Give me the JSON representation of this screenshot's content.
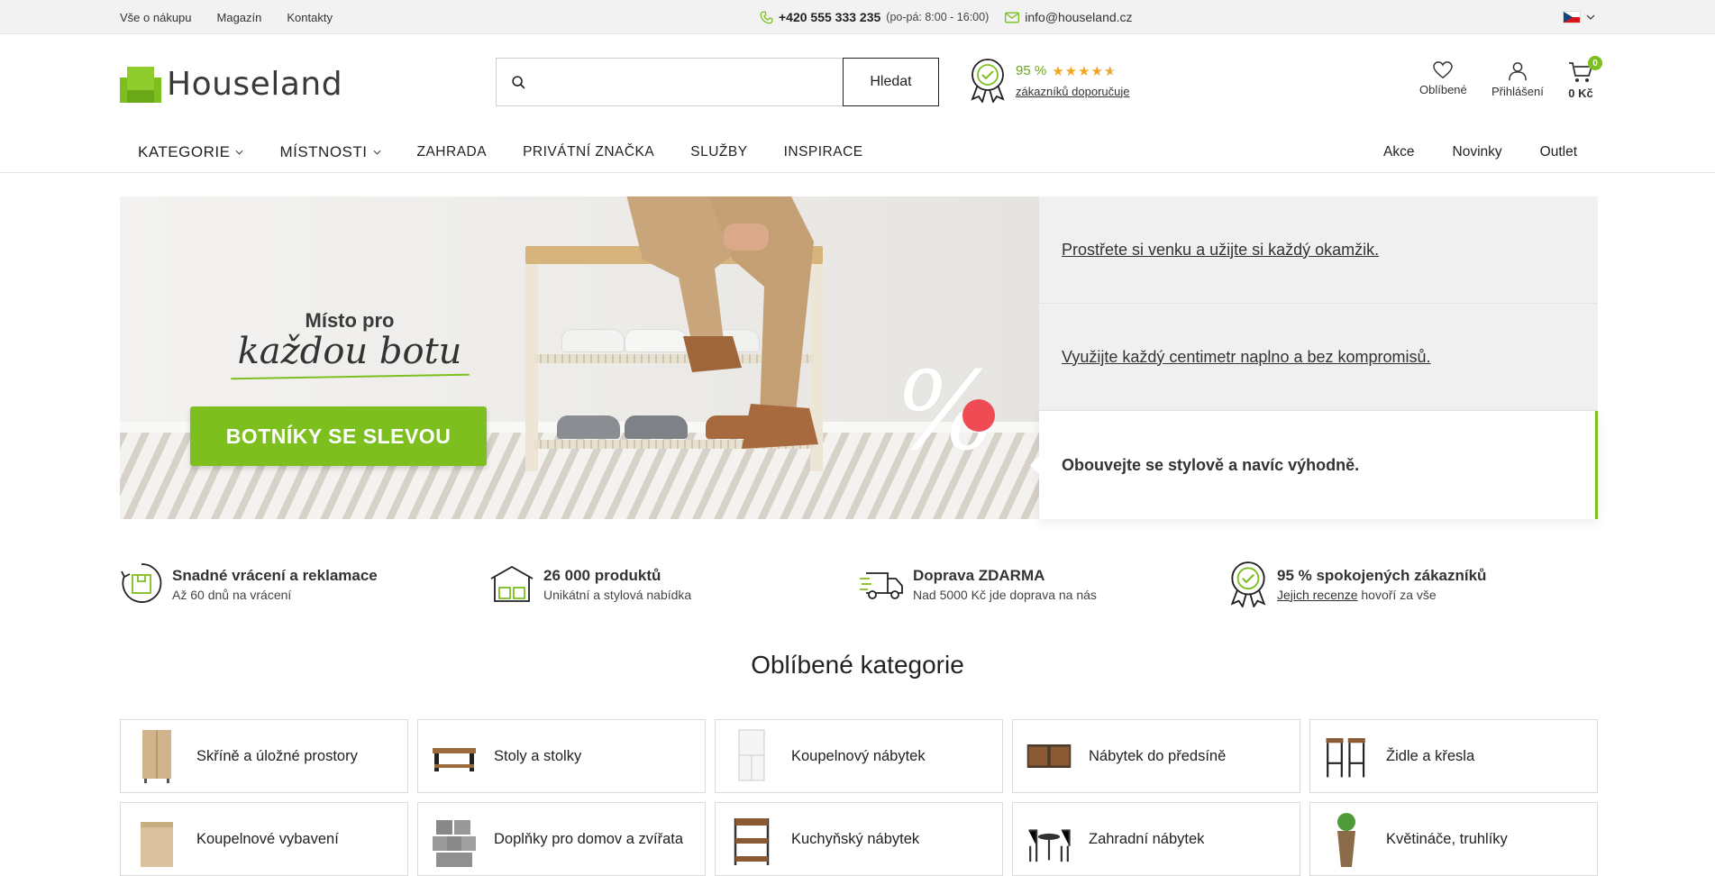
{
  "topbar": {
    "links": [
      "Vše o nákupu",
      "Magazín",
      "Kontakty"
    ],
    "phone": "+420 555 333 235",
    "hours": "(po-pá: 8:00 - 16:00)",
    "email": "info@houseland.cz",
    "language": "CZ"
  },
  "header": {
    "logo_text": "Houseland",
    "search": {
      "placeholder": "",
      "button": "Hledat"
    },
    "rating": {
      "percent": "95 %",
      "stars": 4.5,
      "text": "zákazníků doporučuje"
    },
    "favorites": "Oblíbené",
    "login": "Přihlášení",
    "cart": {
      "count": "0",
      "price": "0 Kč"
    }
  },
  "nav": {
    "left": [
      {
        "label": "KATEGORIE",
        "dropdown": true
      },
      {
        "label": "MÍSTNOSTI",
        "dropdown": true
      },
      {
        "label": "ZAHRADA",
        "dropdown": false
      },
      {
        "label": "PRIVÁTNÍ ZNAČKA",
        "dropdown": false
      },
      {
        "label": "SLUŽBY",
        "dropdown": false
      },
      {
        "label": "INSPIRACE",
        "dropdown": false
      }
    ],
    "right": [
      "Akce",
      "Novinky",
      "Outlet"
    ]
  },
  "hero": {
    "banner_line1": "Místo pro",
    "banner_line2": "každou botu",
    "banner_cta": "BOTNÍKY SE SLEVOU",
    "banner_symbol": "%",
    "promos": [
      "Prostřete si venku a užijte si každý okamžik.",
      "Využijte každý centimetr naplno a bez kompromisů.",
      "Obouvejte se stylově a navíc výhodně."
    ]
  },
  "benefits": [
    {
      "title": "Snadné vrácení a reklamace",
      "subtitle": "Až 60 dnů na vrácení",
      "icon": "return-box-icon"
    },
    {
      "title": "26 000 produktů",
      "subtitle": "Unikátní a stylová nabídka",
      "icon": "warehouse-icon"
    },
    {
      "title": "Doprava ZDARMA",
      "subtitle": "Nad 5000 Kč jde doprava na nás",
      "icon": "truck-icon"
    },
    {
      "title": "95 % spokojených zákazníků",
      "subtitle_link": "Jejich recenze",
      "subtitle_rest": " hovoří za vše",
      "icon": "badge-icon"
    }
  ],
  "categories": {
    "title": "Oblíbené kategorie",
    "items": [
      "Skříně a úložné prostory",
      "Stoly a stolky",
      "Koupelnový nábytek",
      "Nábytek do předsíně",
      "Židle a křesla",
      "Koupelnové vybavení",
      "Doplňky pro domov a zvířata",
      "Kuchyňský nábytek",
      "Zahradní nábytek",
      "Květináče, truhlíky"
    ]
  },
  "colors": {
    "accent": "#7cbf1f",
    "star": "#f0a623",
    "sale_dot": "#ee4b55"
  }
}
